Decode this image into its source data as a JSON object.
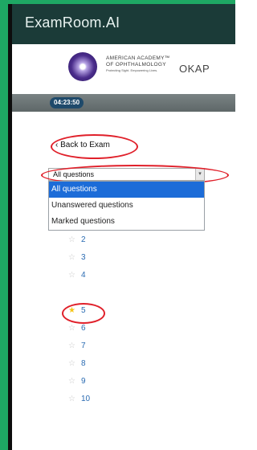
{
  "app": {
    "title": "ExamRoom.AI"
  },
  "header": {
    "org_line1": "AMERICAN ACADEMY™",
    "org_line2": "OF OPHTHALMOLOGY",
    "org_tagline": "Protecting Sight. Empowering Lives.",
    "exam_name": "OKAP"
  },
  "timer": {
    "value": "04:23:50"
  },
  "nav": {
    "back_label": "‹ Back to Exam"
  },
  "filter": {
    "selected": "All questions",
    "options": [
      "All questions",
      "Unanswered questions",
      "Marked questions"
    ]
  },
  "questions": [
    {
      "label": "2",
      "marked": false
    },
    {
      "label": "3",
      "marked": false
    },
    {
      "label": "4",
      "marked": false
    },
    {
      "label": "5",
      "marked": true
    },
    {
      "label": "6",
      "marked": false
    },
    {
      "label": "7",
      "marked": false
    },
    {
      "label": "8",
      "marked": false
    },
    {
      "label": "9",
      "marked": false
    },
    {
      "label": "10",
      "marked": false
    }
  ],
  "colors": {
    "frame": "#1ea864",
    "topbar": "#1b3b38",
    "accent_link": "#2a6bb2",
    "annotation": "#e0202a",
    "marked_star": "#f5c518",
    "dropdown_selected": "#1c6cd8"
  }
}
